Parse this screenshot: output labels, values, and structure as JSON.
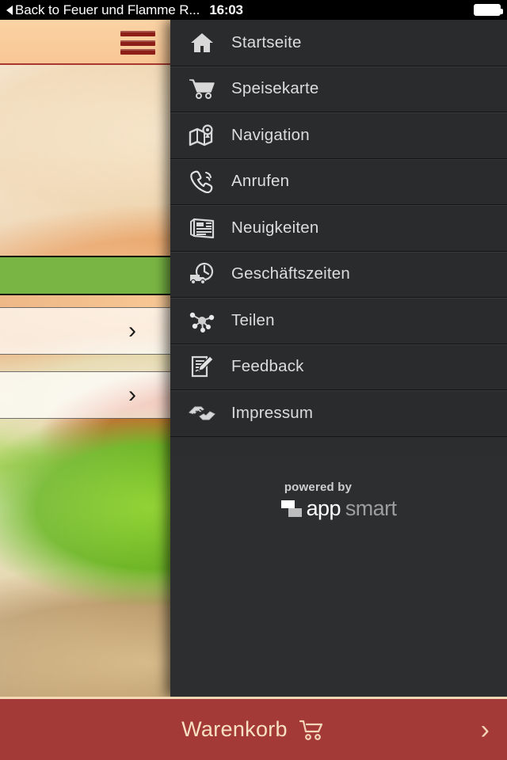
{
  "status_bar": {
    "back_label": "Back to Feuer und Flamme R...",
    "back_icon": "triangle-left-icon",
    "time": "16:03",
    "battery_icon": "battery-full-icon"
  },
  "app_background": {
    "menu_toggle_icon": "hamburger-icon",
    "rows": [
      {
        "chevron": "›"
      },
      {
        "chevron": "›"
      }
    ]
  },
  "menu": {
    "items": [
      {
        "label": "Startseite",
        "icon": "home-icon"
      },
      {
        "label": "Speisekarte",
        "icon": "shopping-cart-icon"
      },
      {
        "label": "Navigation",
        "icon": "map-pin-icon"
      },
      {
        "label": "Anrufen",
        "icon": "phone-icon"
      },
      {
        "label": "Neuigkeiten",
        "icon": "newspaper-icon"
      },
      {
        "label": "Geschäftszeiten",
        "icon": "clock-truck-icon"
      },
      {
        "label": "Teilen",
        "icon": "share-nodes-icon"
      },
      {
        "label": "Feedback",
        "icon": "edit-document-icon"
      },
      {
        "label": "Impressum",
        "icon": "handshake-icon"
      }
    ],
    "branding": {
      "powered_by": "powered by",
      "name_primary": "app",
      "name_secondary": "smart",
      "logo_icon": "appsmart-logo-icon"
    }
  },
  "cart_bar": {
    "label": "Warenkorb",
    "cart_icon": "shopping-cart-icon",
    "chevron_icon": "chevron-right-icon",
    "chevron": "›"
  },
  "colors": {
    "menu_background": "#292b2d",
    "menu_text": "#dcdcdc",
    "cart_bar_background": "#a33a38",
    "cart_bar_text": "#f7e0c4",
    "header_background": "#f8c695",
    "hamburger": "#8e1f18",
    "accent_green": "#79b544"
  }
}
